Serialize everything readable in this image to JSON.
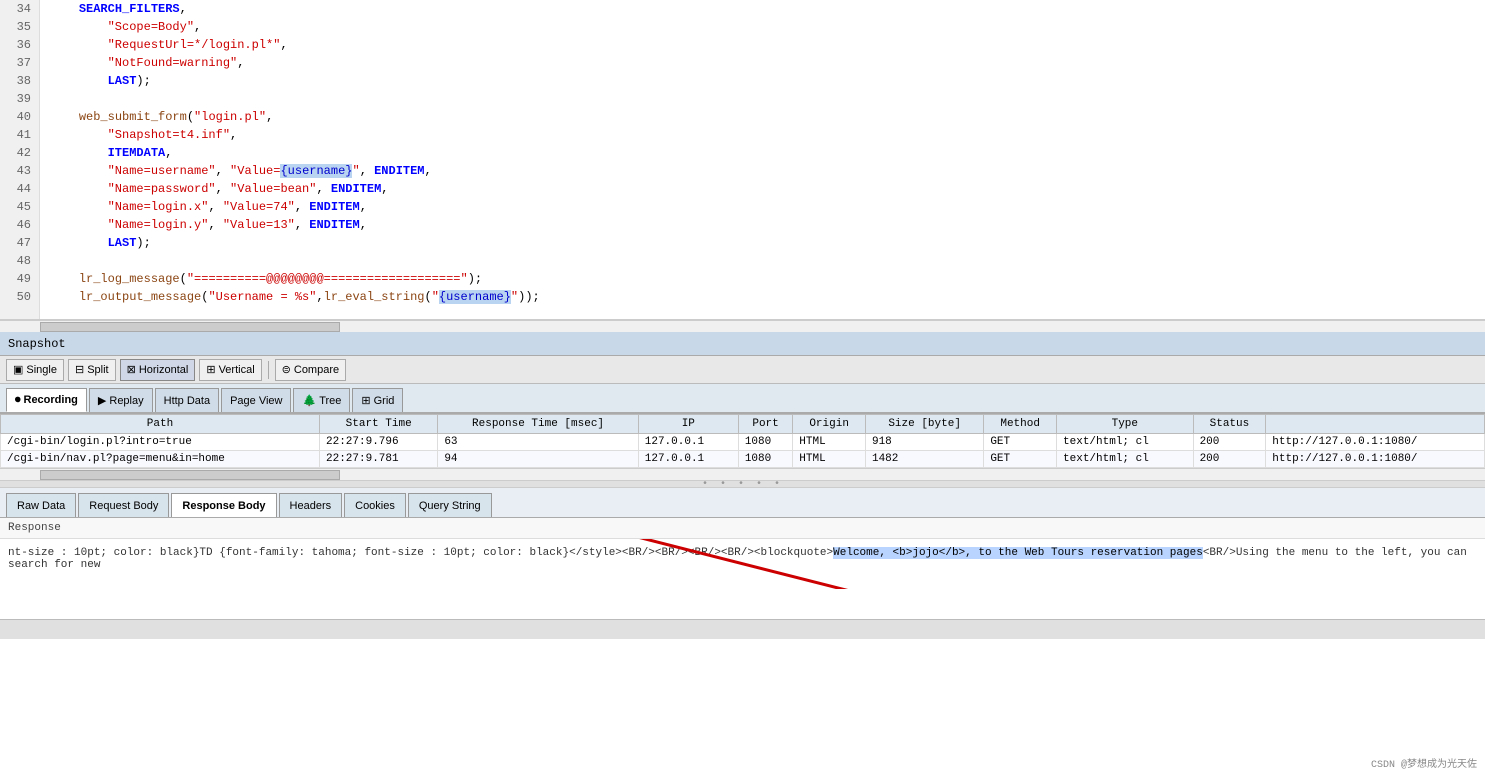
{
  "snapshot": {
    "title": "Snapshot"
  },
  "toolbar": {
    "single_label": "Single",
    "split_label": "Split",
    "horizontal_label": "Horizontal",
    "vertical_label": "Vertical",
    "compare_label": "Compare"
  },
  "tabs": {
    "recording_label": "Recording",
    "replay_label": "Replay",
    "http_data_label": "Http Data",
    "page_view_label": "Page View",
    "tree_label": "Tree",
    "grid_label": "Grid"
  },
  "table": {
    "columns": [
      "Path",
      "Start Time",
      "Response Time [msec]",
      "IP",
      "Port",
      "Origin",
      "Size [byte]",
      "Method",
      "Type",
      "Status"
    ],
    "rows": [
      {
        "path": "/cgi-bin/login.pl?intro=true",
        "start_time": "22:27:9.796",
        "response_time": "63",
        "ip": "127.0.0.1",
        "port": "1080",
        "origin": "HTML",
        "size": "918",
        "method": "GET",
        "type": "text/html; cl",
        "status": "200",
        "url": "http://127.0.0.1:1080/"
      },
      {
        "path": "/cgi-bin/nav.pl?page=menu&in=home",
        "start_time": "22:27:9.781",
        "response_time": "94",
        "ip": "127.0.0.1",
        "port": "1080",
        "origin": "HTML",
        "size": "1482",
        "method": "GET",
        "type": "text/html; cl",
        "status": "200",
        "url": "http://127.0.0.1:1080/"
      }
    ]
  },
  "bottom_tabs": {
    "raw_data": "Raw Data",
    "request_body": "Request Body",
    "response_body": "Response Body",
    "headers": "Headers",
    "cookies": "Cookies",
    "query_string": "Query String"
  },
  "response": {
    "label": "Response",
    "content_before": "nt-size : 10pt; color: black}TD {font-family: tahoma; font-size : 10pt; color: black}</style><BR/><BR/><BR/><BR/><blockquote>",
    "content_highlight": "Welcome, <b>jojo</b>, to the Web Tours reservation pages",
    "content_after": "<BR/>Using the menu to the left, you can search for new"
  },
  "code_lines": [
    {
      "num": "34",
      "content": "    SEARCH_FILTERS,"
    },
    {
      "num": "35",
      "content": "        \"Scope=Body\","
    },
    {
      "num": "36",
      "content": "        \"RequestUrl=*/login.pl*\","
    },
    {
      "num": "37",
      "content": "        \"NotFound=warning\","
    },
    {
      "num": "38",
      "content": "        LAST);"
    },
    {
      "num": "39",
      "content": ""
    },
    {
      "num": "40",
      "content": "    web_submit_form(\"login.pl\","
    },
    {
      "num": "41",
      "content": "        \"Snapshot=t4.inf\","
    },
    {
      "num": "42",
      "content": "        ITEMDATA,"
    },
    {
      "num": "43",
      "content": "        \"Name=username\", \"Value={username}\", ENDITEM,"
    },
    {
      "num": "44",
      "content": "        \"Name=password\", \"Value=bean\", ENDITEM,"
    },
    {
      "num": "45",
      "content": "        \"Name=login.x\", \"Value=74\", ENDITEM,"
    },
    {
      "num": "46",
      "content": "        \"Name=login.y\", \"Value=13\", ENDITEM,"
    },
    {
      "num": "47",
      "content": "        LAST);"
    },
    {
      "num": "48",
      "content": ""
    },
    {
      "num": "49",
      "content": "    lr_log_message(\"==========@@@@@@@@==================\");"
    },
    {
      "num": "50",
      "content": "    lr_output_message(\"Username = %s\",lr_eval_string(\"{username}\"));"
    }
  ],
  "watermark": "CSDN @梦想成为光天佐"
}
